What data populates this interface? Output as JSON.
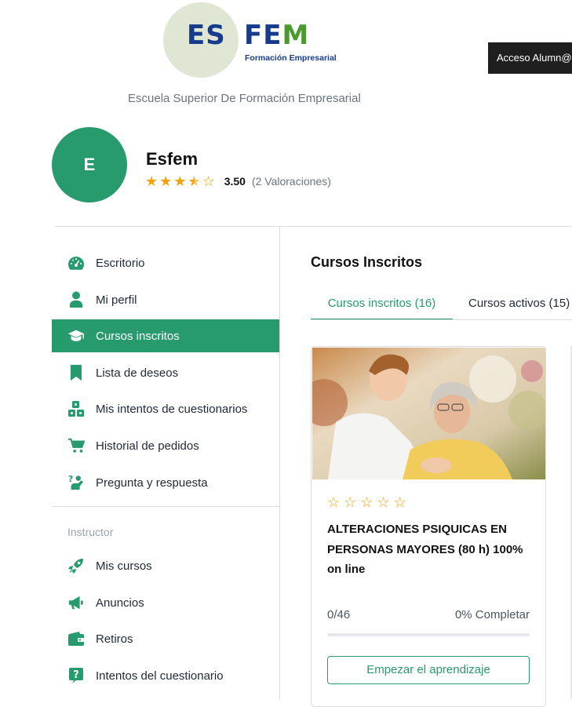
{
  "header": {
    "logo_text_es": "ES",
    "logo_text_fe": "FE",
    "logo_text_m": "M",
    "logo_subtitle": "Formación Empresarial",
    "school_name": "Escuela Superior De Formación Empresarial",
    "login_button": "Acceso Alumn@"
  },
  "profile": {
    "avatar_initial": "E",
    "name": "Esfem",
    "rating_value": "3.50",
    "rating_count": "(2 Valoraciones)",
    "stars": 3.5
  },
  "sidebar": {
    "items": [
      {
        "label": "Escritorio",
        "icon": "dashboard-icon"
      },
      {
        "label": "Mi perfil",
        "icon": "user-icon"
      },
      {
        "label": "Cursos inscritos",
        "icon": "graduation-cap-icon",
        "active": true
      },
      {
        "label": "Lista de deseos",
        "icon": "bookmark-icon"
      },
      {
        "label": "Mis intentos de cuestionarios",
        "icon": "quiz-blocks-icon"
      },
      {
        "label": "Historial de pedidos",
        "icon": "cart-icon"
      },
      {
        "label": "Pregunta y respuesta",
        "icon": "question-answer-icon"
      }
    ],
    "section_label": "Instructor",
    "instructor_items": [
      {
        "label": "Mis cursos",
        "icon": "rocket-icon"
      },
      {
        "label": "Anuncios",
        "icon": "megaphone-icon"
      },
      {
        "label": "Retiros",
        "icon": "wallet-icon"
      },
      {
        "label": "Intentos del cuestionario",
        "icon": "question-icon"
      }
    ]
  },
  "main": {
    "title": "Cursos Inscritos",
    "tabs": [
      {
        "label": "Cursos inscritos (16)",
        "active": true
      },
      {
        "label": "Cursos activos (15)"
      }
    ],
    "course_card": {
      "title": "ALTERACIONES PSIQUICAS EN PERSONAS MAYORES (80 h) 100% on line",
      "progress_text": "0/46",
      "completion_text": "0% Completar",
      "progress": 0,
      "button": "Empezar el aprendizaje",
      "rating_stars": 0
    }
  },
  "colors": {
    "accent": "#279a6e",
    "star": "#f2a20d",
    "logo_blue": "#163b8c",
    "logo_green": "#4a9a2e"
  }
}
